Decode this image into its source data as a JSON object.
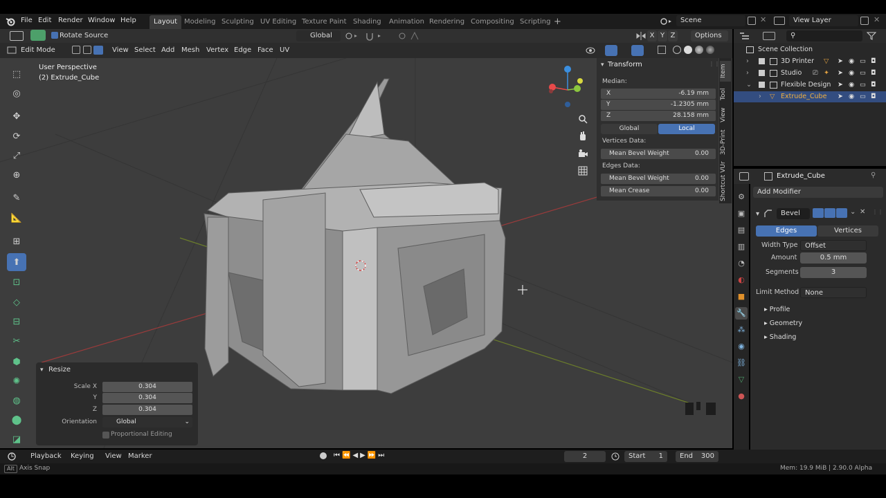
{
  "menu": {
    "file": "File",
    "edit": "Edit",
    "render": "Render",
    "window": "Window",
    "help": "Help"
  },
  "workspaces": [
    "Layout",
    "Modeling",
    "Sculpting",
    "UV Editing",
    "Texture Paint",
    "Shading",
    "Animation",
    "Rendering",
    "Compositing",
    "Scripting"
  ],
  "active_workspace": "Layout",
  "scene": {
    "label": "Scene",
    "view_layer": "View Layer"
  },
  "tool_header": {
    "rotate_source": "Rotate Source",
    "orientation": "Global",
    "options": "Options",
    "axes": [
      "X",
      "Y",
      "Z"
    ]
  },
  "editor_header": {
    "mode": "Edit Mode",
    "menus": [
      "View",
      "Select",
      "Add",
      "Mesh",
      "Vertex",
      "Edge",
      "Face",
      "UV"
    ]
  },
  "viewport": {
    "perspective": "User Perspective",
    "object": "(2) Extrude_Cube"
  },
  "npanel": {
    "title": "Transform",
    "median": "Median:",
    "x_label": "X",
    "x_value": "-6.19 mm",
    "y_label": "Y",
    "y_value": "-1.2305 mm",
    "z_label": "Z",
    "z_value": "28.158 mm",
    "global": "Global",
    "local": "Local",
    "vertices_data": "Vertices Data:",
    "mean_bevel_weight_v": "Mean Bevel Weight",
    "mean_bevel_weight_v_value": "0.00",
    "edges_data": "Edges Data:",
    "mean_bevel_weight_e": "Mean Bevel Weight",
    "mean_bevel_weight_e_value": "0.00",
    "mean_crease": "Mean Crease",
    "mean_crease_value": "0.00",
    "tabs": [
      "Item",
      "Tool",
      "View",
      "3D-Print",
      "Shortcut VUr"
    ]
  },
  "resize_panel": {
    "title": "Resize",
    "scale_x_label": "Scale X",
    "scale_x": "0.304",
    "y_label": "Y",
    "scale_y": "0.304",
    "z_label": "Z",
    "scale_z": "0.304",
    "orientation_label": "Orientation",
    "orientation": "Global",
    "proportional": "Proportional Editing"
  },
  "outliner": {
    "root": "Scene Collection",
    "items": [
      "3D Printer",
      "Studio",
      "Flexible Design",
      "Extrude_Cube"
    ]
  },
  "properties": {
    "object": "Extrude_Cube",
    "add_modifier": "Add Modifier",
    "modifier": "Bevel",
    "edges": "Edges",
    "vertices": "Vertices",
    "width_type_label": "Width Type",
    "width_type": "Offset",
    "amount_label": "Amount",
    "amount": "0.5 mm",
    "segments_label": "Segments",
    "segments": "3",
    "limit_label": "Limit Method",
    "limit": "None",
    "profile": "Profile",
    "geometry": "Geometry",
    "shading": "Shading"
  },
  "timeline": {
    "playback": "Playback",
    "keying": "Keying",
    "view": "View",
    "marker": "Marker",
    "frame": "2",
    "start_label": "Start",
    "start": "1",
    "end_label": "End",
    "end": "300"
  },
  "status": {
    "alt": "Alt",
    "hint": "Axis Snap",
    "memory": "Mem: 19.9 MiB | 2.90.0 Alpha"
  },
  "colors": {
    "accent": "#4772b3",
    "viewport": "#3d3d3d",
    "x_axis": "#e84a4a",
    "y_axis": "#8cc63f",
    "z_axis": "#3b8fe0"
  }
}
